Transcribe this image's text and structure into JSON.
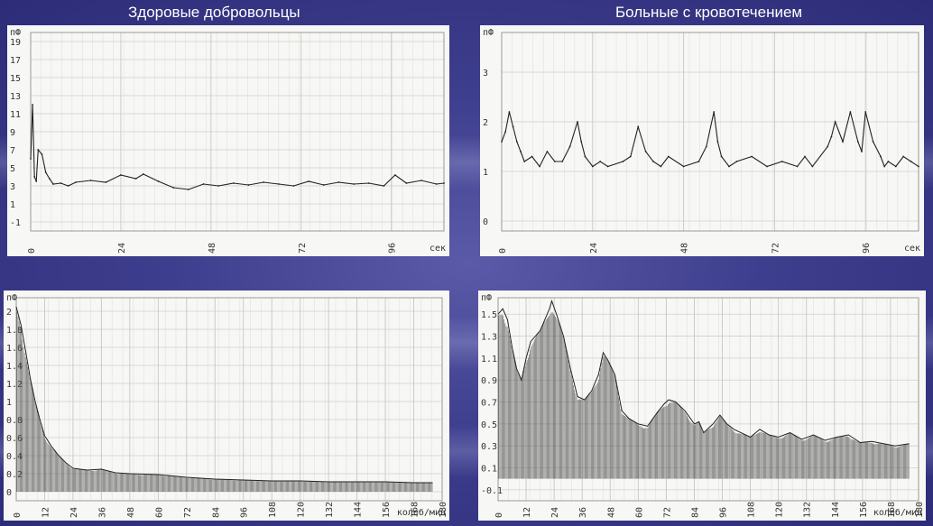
{
  "headings": {
    "left": "Здоровые добровольцы",
    "right": "Больные с кровотечением"
  },
  "chart_data": [
    {
      "type": "line",
      "ylabel": "пФ",
      "xunit": "сек",
      "xticks": [
        "0",
        "24",
        "48",
        "72",
        "96"
      ],
      "yticks": [
        "-1",
        "1",
        "3",
        "5",
        "7",
        "9",
        "11",
        "13",
        "15",
        "17",
        "19"
      ],
      "xlim": [
        0,
        110
      ],
      "ylim": [
        -2,
        20
      ],
      "grid": true,
      "series": [
        {
          "x": [
            0,
            0.5,
            1,
            1.5,
            2,
            3,
            4,
            5,
            6,
            8,
            10,
            12,
            16,
            20,
            24,
            28,
            30,
            34,
            38,
            42,
            46,
            50,
            54,
            58,
            62,
            66,
            70,
            74,
            78,
            82,
            86,
            90,
            94,
            97,
            100,
            104,
            108,
            110
          ],
          "y": [
            6,
            12,
            4,
            3.5,
            7,
            6.5,
            4.5,
            3.8,
            3.2,
            3.3,
            3.0,
            3.4,
            3.6,
            3.4,
            4.2,
            3.8,
            4.3,
            3.5,
            2.8,
            2.6,
            3.2,
            3.0,
            3.3,
            3.1,
            3.4,
            3.2,
            3.0,
            3.5,
            3.1,
            3.4,
            3.2,
            3.3,
            3.0,
            4.2,
            3.3,
            3.6,
            3.2,
            3.3
          ]
        }
      ]
    },
    {
      "type": "line",
      "ylabel": "пФ",
      "xunit": "сек",
      "xticks": [
        "0",
        "24",
        "48",
        "72",
        "96"
      ],
      "yticks": [
        "0",
        "1",
        "2",
        "3"
      ],
      "xlim": [
        0,
        110
      ],
      "ylim": [
        -0.2,
        3.8
      ],
      "grid": true,
      "series": [
        {
          "x": [
            0,
            1,
            2,
            3,
            4,
            5,
            6,
            8,
            10,
            12,
            14,
            16,
            18,
            20,
            21,
            22,
            24,
            26,
            28,
            32,
            34,
            36,
            38,
            40,
            42,
            44,
            48,
            52,
            54,
            56,
            57,
            58,
            60,
            62,
            66,
            70,
            74,
            78,
            80,
            82,
            86,
            87,
            88,
            90,
            92,
            94,
            95,
            96,
            98,
            100,
            101,
            102,
            104,
            106,
            108,
            110
          ],
          "y": [
            1.6,
            1.8,
            2.2,
            1.9,
            1.6,
            1.4,
            1.2,
            1.3,
            1.1,
            1.4,
            1.2,
            1.2,
            1.5,
            2.0,
            1.6,
            1.3,
            1.1,
            1.2,
            1.1,
            1.2,
            1.3,
            1.9,
            1.4,
            1.2,
            1.1,
            1.3,
            1.1,
            1.2,
            1.5,
            2.2,
            1.6,
            1.3,
            1.1,
            1.2,
            1.3,
            1.1,
            1.2,
            1.1,
            1.3,
            1.1,
            1.5,
            1.7,
            2.0,
            1.6,
            2.2,
            1.6,
            1.4,
            2.2,
            1.6,
            1.3,
            1.1,
            1.2,
            1.1,
            1.3,
            1.2,
            1.1
          ]
        }
      ]
    },
    {
      "type": "area",
      "ylabel": "пФ",
      "xunit": "колеб/мин",
      "xticks": [
        "0",
        "12",
        "24",
        "36",
        "48",
        "60",
        "72",
        "84",
        "96",
        "108",
        "120",
        "132",
        "144",
        "156",
        "168",
        "180"
      ],
      "yticks": [
        "0",
        "0.2",
        "0.4",
        "0.6",
        "0.8",
        "1",
        "1.2",
        "1.4",
        "1.6",
        "1.8",
        "2"
      ],
      "xlim": [
        0,
        180
      ],
      "ylim": [
        -0.1,
        2.15
      ],
      "grid": true,
      "series": [
        {
          "x": [
            0,
            2,
            4,
            6,
            8,
            10,
            12,
            15,
            18,
            21,
            24,
            30,
            36,
            42,
            48,
            60,
            72,
            84,
            96,
            108,
            120,
            132,
            144,
            156,
            168,
            176
          ],
          "y": [
            2.05,
            1.85,
            1.55,
            1.25,
            1.0,
            0.8,
            0.62,
            0.5,
            0.4,
            0.32,
            0.26,
            0.24,
            0.25,
            0.21,
            0.2,
            0.19,
            0.16,
            0.14,
            0.13,
            0.12,
            0.12,
            0.11,
            0.11,
            0.11,
            0.1,
            0.1
          ]
        }
      ]
    },
    {
      "type": "area",
      "ylabel": "пФ",
      "xunit": "колеб/мин",
      "xticks": [
        "0",
        "12",
        "24",
        "36",
        "48",
        "60",
        "72",
        "84",
        "96",
        "108",
        "120",
        "132",
        "144",
        "156",
        "168",
        "180"
      ],
      "yticks": [
        "-0.1",
        "0.1",
        "0.3",
        "0.5",
        "0.7",
        "0.9",
        "1.1",
        "1.3",
        "1.5"
      ],
      "xlim": [
        0,
        180
      ],
      "ylim": [
        -0.2,
        1.65
      ],
      "grid": true,
      "series": [
        {
          "x": [
            0,
            2,
            4,
            6,
            8,
            10,
            12,
            14,
            16,
            18,
            20,
            22,
            23,
            25,
            28,
            31,
            34,
            37,
            40,
            43,
            45,
            47,
            50,
            53,
            56,
            60,
            64,
            68,
            71,
            73,
            76,
            80,
            84,
            86,
            88,
            92,
            95,
            98,
            101,
            104,
            108,
            112,
            116,
            120,
            125,
            130,
            135,
            140,
            145,
            150,
            155,
            160,
            165,
            170,
            176
          ],
          "y": [
            1.5,
            1.55,
            1.45,
            1.2,
            1.0,
            0.9,
            1.1,
            1.25,
            1.3,
            1.35,
            1.45,
            1.55,
            1.62,
            1.5,
            1.3,
            1.0,
            0.75,
            0.72,
            0.8,
            0.95,
            1.15,
            1.08,
            0.95,
            0.62,
            0.55,
            0.5,
            0.48,
            0.6,
            0.68,
            0.72,
            0.7,
            0.62,
            0.5,
            0.52,
            0.42,
            0.5,
            0.58,
            0.5,
            0.45,
            0.42,
            0.38,
            0.45,
            0.4,
            0.38,
            0.42,
            0.36,
            0.4,
            0.35,
            0.38,
            0.4,
            0.33,
            0.34,
            0.32,
            0.3,
            0.32
          ]
        }
      ]
    }
  ]
}
